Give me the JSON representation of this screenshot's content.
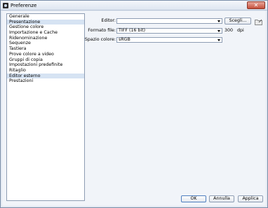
{
  "window": {
    "title": "Preferenze",
    "close_glyph": "✕"
  },
  "sidebar": {
    "items": [
      {
        "label": "Generale"
      },
      {
        "label": "Presentazione"
      },
      {
        "label": "Gestione colore"
      },
      {
        "label": "Importazione e Cache"
      },
      {
        "label": "Ridenominazione"
      },
      {
        "label": "Sequenze"
      },
      {
        "label": "Tastiera"
      },
      {
        "label": "Prove colore a video"
      },
      {
        "label": "Gruppi di copia"
      },
      {
        "label": "Impostazioni predefinite"
      },
      {
        "label": "Ritaglio"
      },
      {
        "label": "Editor esterno"
      },
      {
        "label": "Prestazioni"
      }
    ],
    "selected_index": 11
  },
  "editor": {
    "editor_label": "Editor:",
    "editor_value": "",
    "browse_button": "Scegli...",
    "folder_icon": "folder-icon",
    "format_label": "Formato file:",
    "format_value": "TIFF (16 bit)",
    "dpi_value": "300",
    "dpi_unit": "dpi",
    "colorspace_label": "Spazio colore:",
    "colorspace_value": "sRGB"
  },
  "footer": {
    "ok": "OK",
    "cancel": "Annulla",
    "apply": "Applica"
  },
  "colors": {
    "selection": "#d6e3f3",
    "close": "#c5503c",
    "accent": "#4f7fc0"
  }
}
